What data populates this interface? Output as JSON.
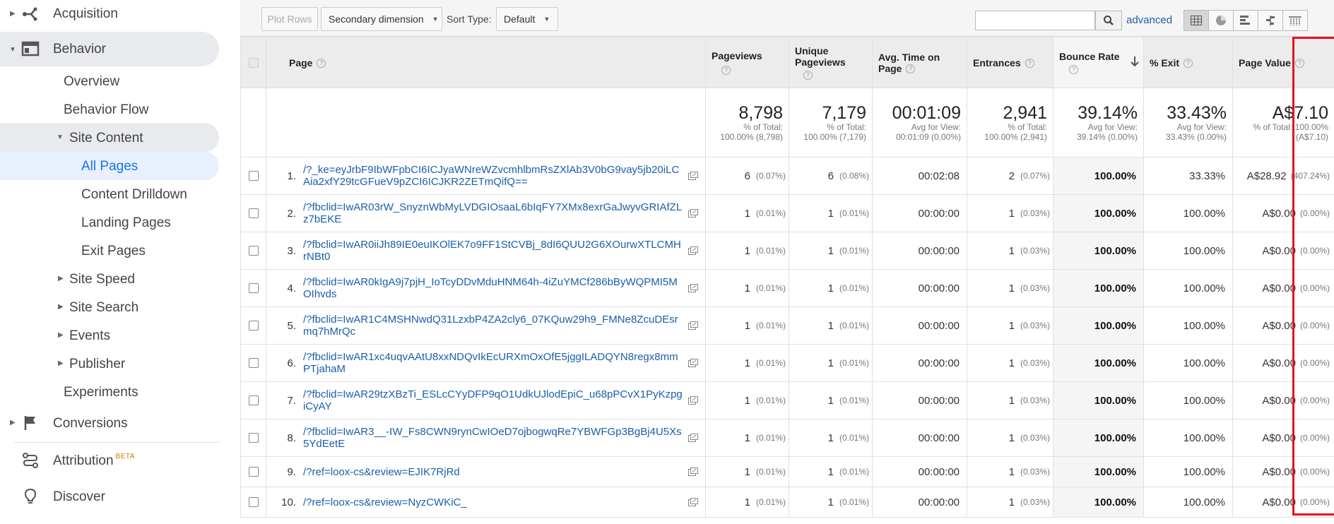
{
  "sidebar": {
    "acquisition": "Acquisition",
    "behavior": "Behavior",
    "overview": "Overview",
    "behavior_flow": "Behavior Flow",
    "site_content": "Site Content",
    "all_pages": "All Pages",
    "content_drilldown": "Content Drilldown",
    "landing_pages": "Landing Pages",
    "exit_pages": "Exit Pages",
    "site_speed": "Site Speed",
    "site_search": "Site Search",
    "events": "Events",
    "publisher": "Publisher",
    "experiments": "Experiments",
    "conversions": "Conversions",
    "attribution": "Attribution",
    "attribution_badge": "BETA",
    "discover": "Discover"
  },
  "toolbar": {
    "plot_rows": "Plot Rows",
    "secondary_dimension": "Secondary dimension",
    "sort_type_label": "Sort Type:",
    "sort_type_value": "Default",
    "advanced": "advanced",
    "view_icons": [
      "table-icon",
      "pie-icon",
      "bar-icon",
      "comparison-icon",
      "pivot-icon"
    ]
  },
  "table": {
    "headers": {
      "page": "Page",
      "pageviews": "Pageviews",
      "unique_pageviews": "Unique Pageviews",
      "avg_time": "Avg. Time on Page",
      "entrances": "Entrances",
      "bounce_rate": "Bounce Rate",
      "exit": "% Exit",
      "page_value": "Page Value"
    },
    "totals": {
      "pageviews": {
        "big": "8,798",
        "sub": "% of Total: 100.00% (8,798)"
      },
      "unique_pageviews": {
        "big": "7,179",
        "sub": "% of Total: 100.00% (7,179)"
      },
      "avg_time": {
        "big": "00:01:09",
        "sub": "Avg for View: 00:01:09 (0.00%)"
      },
      "entrances": {
        "big": "2,941",
        "sub": "% of Total: 100.00% (2,941)"
      },
      "bounce_rate": {
        "big": "39.14%",
        "sub": "Avg for View: 39.14% (0.00%)"
      },
      "exit": {
        "big": "33.43%",
        "sub": "Avg for View: 33.43% (0.00%)"
      },
      "page_value": {
        "big": "A$7.10",
        "sub": "% of Total: 100.00% (A$7.10)"
      }
    },
    "rows": [
      {
        "num": "1.",
        "page": "/?_ke=eyJrbF9IbWFpbCI6ICJyaWNreWZvcmhlbmRsZXlAb3V0bG9vay5jb20iLCAia2xfY29tcGFueV9pZCI6ICJKR2ZETmQifQ==",
        "pageviews": "6",
        "pageviews_pct": "(0.07%)",
        "unique": "6",
        "unique_pct": "(0.08%)",
        "avg_time": "00:02:08",
        "entrances": "2",
        "entrances_pct": "(0.07%)",
        "bounce": "100.00%",
        "exit": "33.33%",
        "value": "A$28.92",
        "value_pct": "(407.24%)"
      },
      {
        "num": "2.",
        "page": "/?fbclid=IwAR03rW_SnyznWbMyLVDGIOsaaL6bIqFY7XMx8exrGaJwyvGRIAfZLz7bEKE",
        "pageviews": "1",
        "pageviews_pct": "(0.01%)",
        "unique": "1",
        "unique_pct": "(0.01%)",
        "avg_time": "00:00:00",
        "entrances": "1",
        "entrances_pct": "(0.03%)",
        "bounce": "100.00%",
        "exit": "100.00%",
        "value": "A$0.00",
        "value_pct": "(0.00%)"
      },
      {
        "num": "3.",
        "page": "/?fbclid=IwAR0iiJh89IE0euIKOlEK7o9FF1StCVBj_8dI6QUU2G6XOurwXTLCMHrNBt0",
        "pageviews": "1",
        "pageviews_pct": "(0.01%)",
        "unique": "1",
        "unique_pct": "(0.01%)",
        "avg_time": "00:00:00",
        "entrances": "1",
        "entrances_pct": "(0.03%)",
        "bounce": "100.00%",
        "exit": "100.00%",
        "value": "A$0.00",
        "value_pct": "(0.00%)"
      },
      {
        "num": "4.",
        "page": "/?fbclid=IwAR0kIgA9j7pjH_IoTcyDDvMduHNM64h-4iZuYMCf286bByWQPMI5MOIhvds",
        "pageviews": "1",
        "pageviews_pct": "(0.01%)",
        "unique": "1",
        "unique_pct": "(0.01%)",
        "avg_time": "00:00:00",
        "entrances": "1",
        "entrances_pct": "(0.03%)",
        "bounce": "100.00%",
        "exit": "100.00%",
        "value": "A$0.00",
        "value_pct": "(0.00%)"
      },
      {
        "num": "5.",
        "page": "/?fbclid=IwAR1C4MSHNwdQ31LzxbP4ZA2cly6_07KQuw29h9_FMNe8ZcuDEsrmq7hMrQc",
        "pageviews": "1",
        "pageviews_pct": "(0.01%)",
        "unique": "1",
        "unique_pct": "(0.01%)",
        "avg_time": "00:00:00",
        "entrances": "1",
        "entrances_pct": "(0.03%)",
        "bounce": "100.00%",
        "exit": "100.00%",
        "value": "A$0.00",
        "value_pct": "(0.00%)"
      },
      {
        "num": "6.",
        "page": "/?fbclid=IwAR1xc4uqvAAtU8xxNDQvIkEcURXmOxOfE5jggILADQYN8regx8mmPTjahaM",
        "pageviews": "1",
        "pageviews_pct": "(0.01%)",
        "unique": "1",
        "unique_pct": "(0.01%)",
        "avg_time": "00:00:00",
        "entrances": "1",
        "entrances_pct": "(0.03%)",
        "bounce": "100.00%",
        "exit": "100.00%",
        "value": "A$0.00",
        "value_pct": "(0.00%)"
      },
      {
        "num": "7.",
        "page": "/?fbclid=IwAR29tzXBzTi_ESLcCYyDFP9qO1UdkUJlodEpiC_u68pPCvX1PyKzpgiCyAY",
        "pageviews": "1",
        "pageviews_pct": "(0.01%)",
        "unique": "1",
        "unique_pct": "(0.01%)",
        "avg_time": "00:00:00",
        "entrances": "1",
        "entrances_pct": "(0.03%)",
        "bounce": "100.00%",
        "exit": "100.00%",
        "value": "A$0.00",
        "value_pct": "(0.00%)"
      },
      {
        "num": "8.",
        "page": "/?fbclid=IwAR3__-IW_Fs8CWN9rynCwIOeD7ojbogwqRe7YBWFGp3BgBj4U5Xs5YdEetE",
        "pageviews": "1",
        "pageviews_pct": "(0.01%)",
        "unique": "1",
        "unique_pct": "(0.01%)",
        "avg_time": "00:00:00",
        "entrances": "1",
        "entrances_pct": "(0.03%)",
        "bounce": "100.00%",
        "exit": "100.00%",
        "value": "A$0.00",
        "value_pct": "(0.00%)"
      },
      {
        "num": "9.",
        "page": "/?ref=loox-cs&review=EJIK7RjRd",
        "pageviews": "1",
        "pageviews_pct": "(0.01%)",
        "unique": "1",
        "unique_pct": "(0.01%)",
        "avg_time": "00:00:00",
        "entrances": "1",
        "entrances_pct": "(0.03%)",
        "bounce": "100.00%",
        "exit": "100.00%",
        "value": "A$0.00",
        "value_pct": "(0.00%)"
      },
      {
        "num": "10.",
        "page": "/?ref=loox-cs&review=NyzCWKiC_",
        "pageviews": "1",
        "pageviews_pct": "(0.01%)",
        "unique": "1",
        "unique_pct": "(0.01%)",
        "avg_time": "00:00:00",
        "entrances": "1",
        "entrances_pct": "(0.03%)",
        "bounce": "100.00%",
        "exit": "100.00%",
        "value": "A$0.00",
        "value_pct": "(0.00%)"
      }
    ]
  },
  "colors": {
    "link": "#1a5fa8",
    "accent": "#1a73e8",
    "highlight": "#e8121a"
  }
}
